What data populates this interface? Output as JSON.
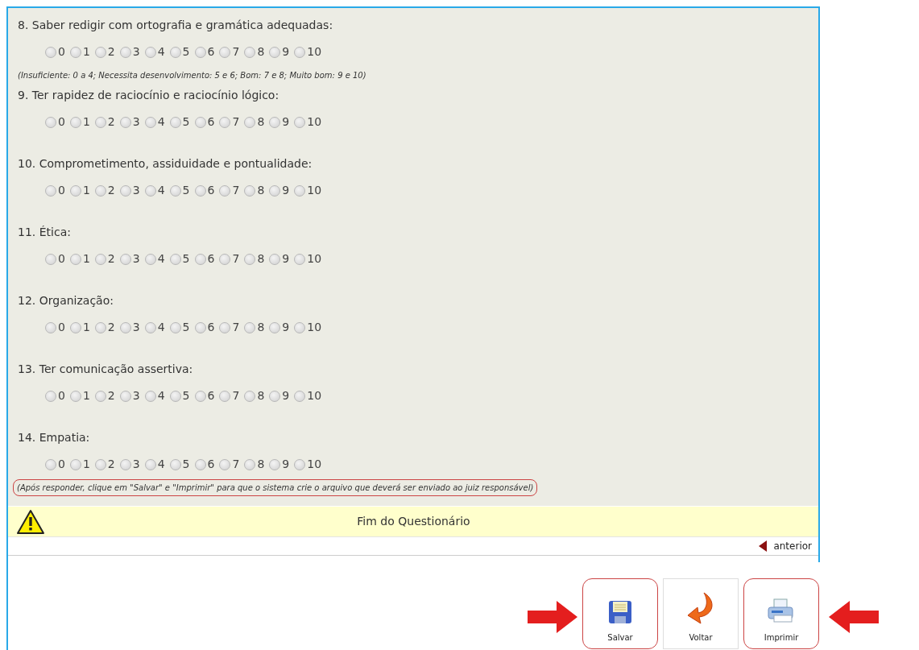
{
  "questions": [
    {
      "title": "8. Saber redigir com ortografia e gramática adequadas:",
      "options": [
        {
          "label": "0",
          "selected": false
        },
        {
          "label": "1",
          "selected": false
        },
        {
          "label": "2",
          "selected": false
        },
        {
          "label": "3",
          "selected": false
        },
        {
          "label": "4",
          "selected": false
        },
        {
          "label": "5",
          "selected": false
        },
        {
          "label": "6",
          "selected": false
        },
        {
          "label": "7",
          "selected": false
        },
        {
          "label": "8",
          "selected": false
        },
        {
          "label": "9",
          "selected": false
        },
        {
          "label": "10",
          "selected": false
        }
      ],
      "note": "(Insuficiente: 0 a 4; Necessita desenvolvimento: 5 e 6; Bom: 7 e 8; Muito bom: 9 e 10)",
      "note_highlighted": false
    },
    {
      "title": "9. Ter rapidez de raciocínio e raciocínio lógico:",
      "options": [
        {
          "label": "0",
          "selected": false
        },
        {
          "label": "1",
          "selected": false
        },
        {
          "label": "2",
          "selected": false
        },
        {
          "label": "3",
          "selected": false
        },
        {
          "label": "4",
          "selected": false
        },
        {
          "label": "5",
          "selected": false
        },
        {
          "label": "6",
          "selected": false
        },
        {
          "label": "7",
          "selected": false
        },
        {
          "label": "8",
          "selected": false
        },
        {
          "label": "9",
          "selected": false
        },
        {
          "label": "10",
          "selected": false
        }
      ]
    },
    {
      "title": "10. Comprometimento, assiduidade e pontualidade:",
      "options": [
        {
          "label": "0",
          "selected": false
        },
        {
          "label": "1",
          "selected": false
        },
        {
          "label": "2",
          "selected": false
        },
        {
          "label": "3",
          "selected": false
        },
        {
          "label": "4",
          "selected": false
        },
        {
          "label": "5",
          "selected": false
        },
        {
          "label": "6",
          "selected": false
        },
        {
          "label": "7",
          "selected": false
        },
        {
          "label": "8",
          "selected": false
        },
        {
          "label": "9",
          "selected": false
        },
        {
          "label": "10",
          "selected": false
        }
      ]
    },
    {
      "title": "11. Ética:",
      "options": [
        {
          "label": "0",
          "selected": false
        },
        {
          "label": "1",
          "selected": false
        },
        {
          "label": "2",
          "selected": false
        },
        {
          "label": "3",
          "selected": false
        },
        {
          "label": "4",
          "selected": false
        },
        {
          "label": "5",
          "selected": false
        },
        {
          "label": "6",
          "selected": false
        },
        {
          "label": "7",
          "selected": false
        },
        {
          "label": "8",
          "selected": false
        },
        {
          "label": "9",
          "selected": false
        },
        {
          "label": "10",
          "selected": false
        }
      ]
    },
    {
      "title": "12. Organização:",
      "options": [
        {
          "label": "0",
          "selected": false
        },
        {
          "label": "1",
          "selected": false
        },
        {
          "label": "2",
          "selected": false
        },
        {
          "label": "3",
          "selected": false
        },
        {
          "label": "4",
          "selected": false
        },
        {
          "label": "5",
          "selected": false
        },
        {
          "label": "6",
          "selected": false
        },
        {
          "label": "7",
          "selected": false
        },
        {
          "label": "8",
          "selected": false
        },
        {
          "label": "9",
          "selected": false
        },
        {
          "label": "10",
          "selected": false
        }
      ]
    },
    {
      "title": "13. Ter comunicação assertiva:",
      "options": [
        {
          "label": "0",
          "selected": false
        },
        {
          "label": "1",
          "selected": false
        },
        {
          "label": "2",
          "selected": false
        },
        {
          "label": "3",
          "selected": false
        },
        {
          "label": "4",
          "selected": false
        },
        {
          "label": "5",
          "selected": false
        },
        {
          "label": "6",
          "selected": false
        },
        {
          "label": "7",
          "selected": false
        },
        {
          "label": "8",
          "selected": false
        },
        {
          "label": "9",
          "selected": false
        },
        {
          "label": "10",
          "selected": false
        }
      ]
    },
    {
      "title": "14. Empatia:",
      "options": [
        {
          "label": "0",
          "selected": false
        },
        {
          "label": "1",
          "selected": false
        },
        {
          "label": "2",
          "selected": false
        },
        {
          "label": "3",
          "selected": false
        },
        {
          "label": "4",
          "selected": false
        },
        {
          "label": "5",
          "selected": false
        },
        {
          "label": "6",
          "selected": false
        },
        {
          "label": "7",
          "selected": false
        },
        {
          "label": "8",
          "selected": false
        },
        {
          "label": "9",
          "selected": false
        },
        {
          "label": "10",
          "selected": false
        }
      ],
      "note": "(Após responder, clique em \"Salvar\" e \"Imprimir\" para que o sistema crie o arquivo que deverá ser enviado ao juiz responsável)",
      "note_highlighted": true
    }
  ],
  "end_banner": {
    "text": "Fim do Questionário"
  },
  "pager": {
    "previous": "anterior"
  },
  "buttons": [
    {
      "kind": "save",
      "label": "Salvar",
      "highlighted": true
    },
    {
      "kind": "back",
      "label": "Voltar",
      "highlighted": false
    },
    {
      "kind": "print",
      "label": "Imprimir",
      "highlighted": true
    }
  ]
}
